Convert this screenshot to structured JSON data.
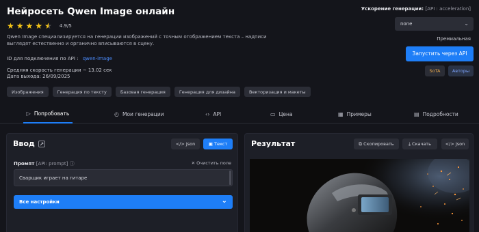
{
  "header": {
    "title": "Нейросеть Qwen Image онлайн",
    "rating": "4.9/5",
    "rating_stars": 4.5,
    "description": "Qwen Image специализируется на генерации изображений с точным отображением текста – надписи выглядят естественно и органично вписываются в сцену.",
    "api_id_label": "ID для подключения по API :",
    "api_id_value": "qwen-image",
    "speed": "Средняя скорость генерации ~ 13.02 сек",
    "release_date": "Дата выхода: 26/09/2025"
  },
  "tags": [
    "Изображения",
    "Генерация по тексту",
    "Базовая генерация",
    "Генерация для дизайна",
    "Векторизация и макеты"
  ],
  "sidebar_right": {
    "accel_label": "Ускорение генерации:",
    "accel_api": "[API : acceleration]",
    "accel_value": "none",
    "premium": "Премиальная",
    "run_button": "Запустить через API",
    "sota": "SoTA",
    "authors": "Авторы"
  },
  "tabs": [
    {
      "label": "Попробовать",
      "icon": "play-icon",
      "active": true
    },
    {
      "label": "Мои генерации",
      "icon": "history-icon"
    },
    {
      "label": "API",
      "icon": "code-icon"
    },
    {
      "label": "Цена",
      "icon": "folder-icon"
    },
    {
      "label": "Примеры",
      "icon": "grid-icon"
    },
    {
      "label": "Подробности",
      "icon": "file-icon"
    }
  ],
  "input_panel": {
    "title": "Ввод",
    "json_button": "</> Json",
    "text_button": "Текст",
    "prompt_label": "Промпт",
    "prompt_api": "[API: prompt]",
    "clear_label": "Очистить поле",
    "prompt_value": "Сварщик играет на гитаре",
    "all_settings": "Все настройки"
  },
  "result_panel": {
    "title": "Результат",
    "copy_button": "Скопировать",
    "download_button": "Скачать",
    "json_button": "</> Json"
  },
  "colors": {
    "accent": "#1e7ef7",
    "background": "#14151b",
    "panel": "#1d1f27",
    "star": "#f5c518",
    "sota": "#e9a84b"
  }
}
